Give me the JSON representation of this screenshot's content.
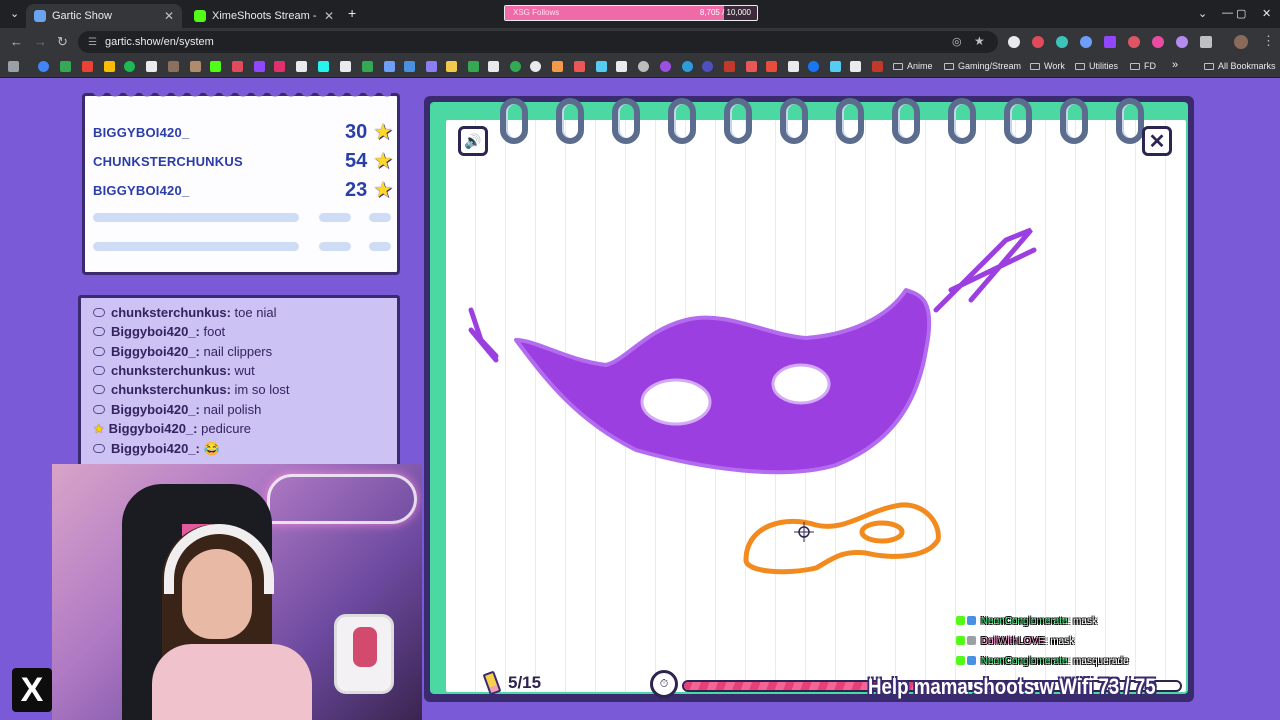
{
  "browser": {
    "tabs": [
      {
        "title": "Gartic Show",
        "close": "✕",
        "favicon_color": "#6ba3f0"
      },
      {
        "title": "XimeShoots Stream - Watch Live",
        "close": "✕",
        "favicon_color": "#53fc18"
      }
    ],
    "new_tab": "+",
    "extension_bar": {
      "label": "XSG Follows",
      "count": "8,705 / 10,000",
      "progress": 0.87
    },
    "url": "gartic.show/en/system",
    "window_controls": [
      "⌄",
      "—",
      "▢",
      "✕"
    ],
    "bookmark_folders": [
      "Anime",
      "Gaming/Stream",
      "Work",
      "Utilities",
      "FD"
    ],
    "all_bookmarks": "All Bookmarks",
    "more_bookmarks": "»"
  },
  "scoreboard": {
    "rows": [
      {
        "name": "BIGGYBOI420_",
        "score": "30"
      },
      {
        "name": "CHUNKSTERCHUNKUS",
        "score": "54"
      },
      {
        "name": "BIGGYBOI420_",
        "score": "23"
      }
    ]
  },
  "chat": {
    "lines": [
      {
        "user": "chunksterchunkus:",
        "msg": "toe nial",
        "starred": false
      },
      {
        "user": "Biggyboi420_:",
        "msg": "foot",
        "starred": false
      },
      {
        "user": "Biggyboi420_:",
        "msg": "nail clippers",
        "starred": false
      },
      {
        "user": "chunksterchunkus:",
        "msg": "wut",
        "starred": false
      },
      {
        "user": "chunksterchunkus:",
        "msg": "im so lost",
        "starred": false
      },
      {
        "user": "Biggyboi420_:",
        "msg": "nail polish",
        "starred": false
      },
      {
        "user": "Biggyboi420_:",
        "msg": "pedicure",
        "starred": true
      },
      {
        "user": "Biggyboi420_:",
        "msg": "😂",
        "starred": false
      }
    ]
  },
  "game": {
    "round": "5/15",
    "timer_remaining": 0.52,
    "sound_icon": "🔊",
    "close_icon": "✕"
  },
  "drawing_colors": {
    "mask": "#9b3fe0",
    "small_mask": "#f28a1e"
  },
  "overlay": {
    "chat": [
      {
        "user": "NeonConglomerate",
        "msg": ": mask",
        "color": "green"
      },
      {
        "user": "DollWithLOVE",
        "msg": ": mask",
        "color": "pink"
      },
      {
        "user": "NeonConglomerate",
        "msg": ": masquerade",
        "color": "green"
      }
    ],
    "title": "Help mama shoots w Wifi 73 / 75"
  },
  "logo": "X"
}
